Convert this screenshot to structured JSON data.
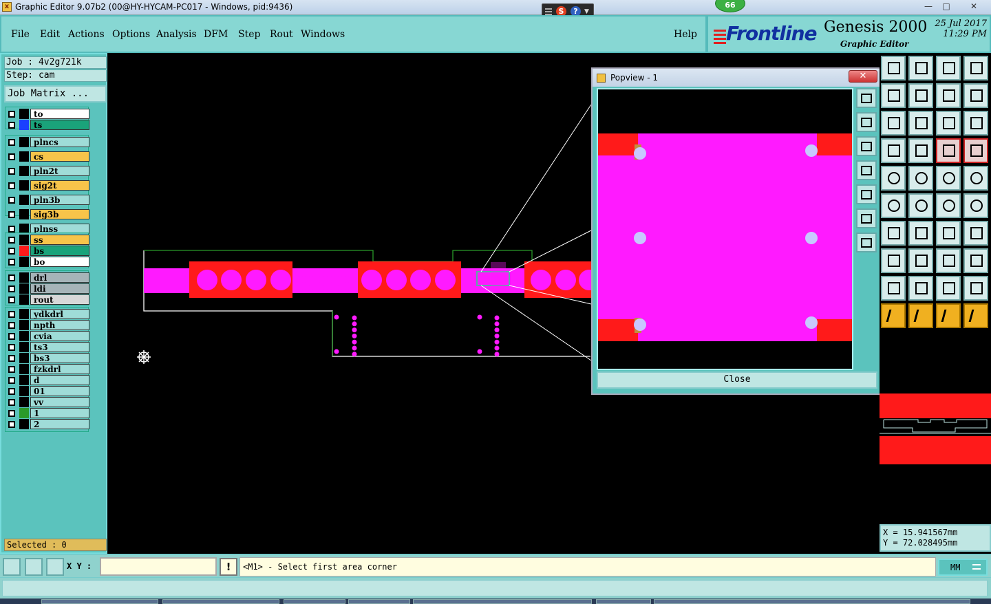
{
  "window": {
    "title": "Graphic Editor 9.07b2 (00@HY-HYCAM-PC017 - Windows, pid:9436)",
    "badge": "66",
    "min_label": "—",
    "max_label": "□",
    "close_label": "✕"
  },
  "menu": {
    "items": [
      "File",
      "Edit",
      "Actions",
      "Options",
      "Analysis",
      "DFM",
      "Step",
      "Rout",
      "Windows"
    ],
    "help": "Help"
  },
  "brand": {
    "logo": "Frontline",
    "product": "Genesis 2000",
    "subtitle": "Graphic Editor",
    "date": "25 Jul 2017",
    "time": "11:29 PM"
  },
  "job": {
    "job_label": "Job : 4v2g721k",
    "step_label": "Step: cam",
    "matrix_button": "Job Matrix ..."
  },
  "layer_groups": [
    [
      {
        "name": "to",
        "bg": "#ffffff",
        "swatch": ""
      },
      {
        "name": "ts",
        "bg": "#1aa37a",
        "swatch": "#1a3fff",
        "active": true
      }
    ],
    [
      {
        "name": "plncs",
        "bg": "#9fdcd8",
        "swatch": ""
      },
      {
        "name": "cs",
        "bg": "#f7c44a",
        "swatch": ""
      },
      {
        "name": "pln2t",
        "bg": "#9fdcd8",
        "swatch": ""
      },
      {
        "name": "sig2t",
        "bg": "#f7c44a",
        "swatch": ""
      },
      {
        "name": "pln3b",
        "bg": "#9fdcd8",
        "swatch": ""
      },
      {
        "name": "sig3b",
        "bg": "#f7c44a",
        "swatch": ""
      },
      {
        "name": "plnss",
        "bg": "#9fdcd8",
        "swatch": ""
      }
    ],
    [
      {
        "name": "ss",
        "bg": "#f7c44a",
        "swatch": ""
      },
      {
        "name": "bs",
        "bg": "#1aa37a",
        "swatch": "#ff1a1a"
      },
      {
        "name": "bo",
        "bg": "#ffffff",
        "swatch": ""
      }
    ],
    [
      {
        "name": "drl",
        "bg": "#a6b4b8",
        "swatch": ""
      },
      {
        "name": "ldi",
        "bg": "#a6b4b8",
        "swatch": ""
      },
      {
        "name": "rout",
        "bg": "#d8d8d8",
        "swatch": ""
      }
    ],
    [
      {
        "name": "ydkdrl",
        "bg": "#9fdcd8",
        "swatch": ""
      },
      {
        "name": "npth",
        "bg": "#9fdcd8",
        "swatch": ""
      },
      {
        "name": "cvia",
        "bg": "#9fdcd8",
        "swatch": ""
      },
      {
        "name": "ts3",
        "bg": "#9fdcd8",
        "swatch": ""
      },
      {
        "name": "bs3",
        "bg": "#9fdcd8",
        "swatch": ""
      },
      {
        "name": "fzkdrl",
        "bg": "#9fdcd8",
        "swatch": ""
      },
      {
        "name": "d",
        "bg": "#9fdcd8",
        "swatch": ""
      },
      {
        "name": "01",
        "bg": "#9fdcd8",
        "swatch": ""
      },
      {
        "name": "vv",
        "bg": "#9fdcd8",
        "swatch": ""
      },
      {
        "name": "1",
        "bg": "#9fdcd8",
        "swatch": "#2a9a2a"
      },
      {
        "name": "2",
        "bg": "#9fdcd8",
        "swatch": ""
      }
    ]
  ],
  "selected": "Selected : 0",
  "popview": {
    "title": "Popview - 1",
    "close_x": "✕",
    "close_button": "Close"
  },
  "coords": {
    "x": "X = 15.941567mm",
    "y": "Y = 72.028495mm"
  },
  "bottom": {
    "xy_label": "X Y :",
    "xy_value": "",
    "warn": "!",
    "status": "<M1> - Select first area corner",
    "units": "MM"
  },
  "colors": {
    "pad": "#ff1a1a",
    "copper": "#ff1aff",
    "outline": "#ffffff",
    "accent_teal": "#5bc3bd"
  }
}
